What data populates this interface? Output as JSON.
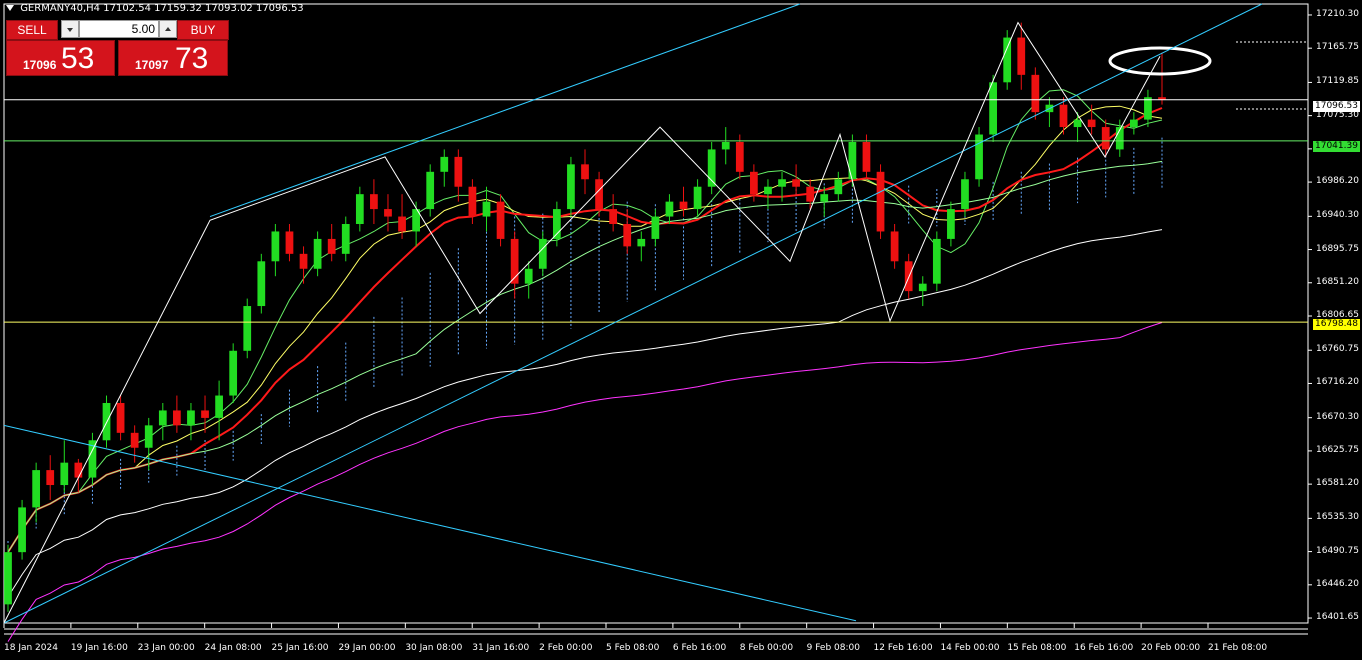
{
  "header": {
    "symbol": "GERMANY40,H4",
    "open": "17102.54",
    "high": "17159.32",
    "low": "17093.02",
    "close": "17096.53"
  },
  "trade_panel": {
    "sell_label": "SELL",
    "buy_label": "BUY",
    "volume": "5.00",
    "bid_small": "17096",
    "bid_big": "53",
    "ask_small": "17097",
    "ask_big": "73"
  },
  "price_labels": {
    "current": "17096.53",
    "green_level": "17041.39",
    "yellow_level": "16798.48",
    "current_bg": "#ffffff",
    "green_bg": "#33dd33",
    "yellow_bg": "#ffff00"
  },
  "colors": {
    "bull": "#22dd22",
    "bear": "#ee1111",
    "ma_red": "#ff1a1a",
    "ma_white": "#ffffff",
    "ma_magenta": "#ff33ff",
    "channel": "#33ccff",
    "cloud": "#66aaff",
    "level_green": "#66ee66",
    "level_yellow": "#ffff66"
  },
  "chart_data": {
    "type": "candlestick",
    "title": "GERMANY40,H4",
    "y_axis_ticks": [
      "17210.30",
      "17165.75",
      "17119.85",
      "17075.30",
      "17030.75",
      "16986.20",
      "16940.30",
      "16895.75",
      "16851.20",
      "16806.65",
      "16760.75",
      "16716.20",
      "16670.30",
      "16625.75",
      "16581.20",
      "16535.30",
      "16490.75",
      "16446.20",
      "16401.65"
    ],
    "ylim": [
      16395,
      17225
    ],
    "x_axis_ticks": [
      "18 Jan 2024",
      "19 Jan 16:00",
      "23 Jan 00:00",
      "24 Jan 08:00",
      "25 Jan 16:00",
      "29 Jan 00:00",
      "30 Jan 08:00",
      "31 Jan 16:00",
      "2 Feb 00:00",
      "5 Feb 08:00",
      "6 Feb 16:00",
      "8 Feb 00:00",
      "9 Feb 08:00",
      "12 Feb 16:00",
      "14 Feb 00:00",
      "15 Feb 08:00",
      "16 Feb 16:00",
      "20 Feb 00:00",
      "21 Feb 08:00"
    ],
    "horizontal_levels": [
      17096.53,
      17041.39,
      16798.48
    ],
    "candles_ohlc": [
      [
        16420,
        16500,
        16410,
        16490
      ],
      [
        16490,
        16560,
        16480,
        16550
      ],
      [
        16550,
        16610,
        16530,
        16600
      ],
      [
        16600,
        16620,
        16560,
        16580
      ],
      [
        16580,
        16640,
        16570,
        16610
      ],
      [
        16610,
        16615,
        16570,
        16590
      ],
      [
        16590,
        16650,
        16580,
        16640
      ],
      [
        16640,
        16700,
        16630,
        16690
      ],
      [
        16690,
        16700,
        16640,
        16650
      ],
      [
        16650,
        16660,
        16610,
        16630
      ],
      [
        16630,
        16670,
        16600,
        16660
      ],
      [
        16660,
        16690,
        16640,
        16680
      ],
      [
        16680,
        16700,
        16650,
        16660
      ],
      [
        16660,
        16690,
        16640,
        16680
      ],
      [
        16680,
        16700,
        16650,
        16670
      ],
      [
        16670,
        16720,
        16640,
        16700
      ],
      [
        16700,
        16770,
        16690,
        16760
      ],
      [
        16760,
        16830,
        16750,
        16820
      ],
      [
        16820,
        16890,
        16810,
        16880
      ],
      [
        16880,
        16930,
        16860,
        16920
      ],
      [
        16920,
        16930,
        16880,
        16890
      ],
      [
        16890,
        16900,
        16850,
        16870
      ],
      [
        16870,
        16920,
        16860,
        16910
      ],
      [
        16910,
        16930,
        16880,
        16890
      ],
      [
        16890,
        16940,
        16880,
        16930
      ],
      [
        16930,
        16980,
        16920,
        16970
      ],
      [
        16970,
        16990,
        16930,
        16950
      ],
      [
        16950,
        16970,
        16920,
        16940
      ],
      [
        16940,
        16970,
        16910,
        16920
      ],
      [
        16920,
        16960,
        16900,
        16950
      ],
      [
        16950,
        17010,
        16940,
        17000
      ],
      [
        17000,
        17030,
        16980,
        17020
      ],
      [
        17020,
        17030,
        16960,
        16980
      ],
      [
        16980,
        16990,
        16930,
        16940
      ],
      [
        16940,
        16980,
        16920,
        16960
      ],
      [
        16960,
        16970,
        16900,
        16910
      ],
      [
        16910,
        16920,
        16830,
        16850
      ],
      [
        16850,
        16880,
        16830,
        16870
      ],
      [
        16870,
        16920,
        16860,
        16910
      ],
      [
        16910,
        16960,
        16900,
        16950
      ],
      [
        16950,
        17020,
        16940,
        17010
      ],
      [
        17010,
        17030,
        16970,
        16990
      ],
      [
        16990,
        17000,
        16940,
        16950
      ],
      [
        16950,
        16970,
        16920,
        16930
      ],
      [
        16930,
        16950,
        16890,
        16900
      ],
      [
        16900,
        16920,
        16880,
        16910
      ],
      [
        16910,
        16950,
        16900,
        16940
      ],
      [
        16940,
        16970,
        16930,
        16960
      ],
      [
        16960,
        16980,
        16940,
        16950
      ],
      [
        16950,
        16990,
        16940,
        16980
      ],
      [
        16980,
        17040,
        16970,
        17030
      ],
      [
        17030,
        17060,
        17010,
        17040
      ],
      [
        17040,
        17050,
        16990,
        17000
      ],
      [
        17000,
        17010,
        16960,
        16970
      ],
      [
        16970,
        16990,
        16950,
        16980
      ],
      [
        16980,
        17000,
        16960,
        16990
      ],
      [
        16990,
        17010,
        16970,
        16980
      ],
      [
        16980,
        16990,
        16950,
        16960
      ],
      [
        16960,
        16980,
        16940,
        16970
      ],
      [
        16970,
        17000,
        16960,
        16990
      ],
      [
        16990,
        17050,
        16980,
        17040
      ],
      [
        17040,
        17050,
        16990,
        17000
      ],
      [
        17000,
        17010,
        16910,
        16920
      ],
      [
        16920,
        16930,
        16870,
        16880
      ],
      [
        16880,
        16890,
        16830,
        16840
      ],
      [
        16840,
        16860,
        16820,
        16850
      ],
      [
        16850,
        16920,
        16840,
        16910
      ],
      [
        16910,
        16960,
        16900,
        16950
      ],
      [
        16950,
        17000,
        16940,
        16990
      ],
      [
        16990,
        17060,
        16980,
        17050
      ],
      [
        17050,
        17130,
        17040,
        17120
      ],
      [
        17120,
        17190,
        17110,
        17180
      ],
      [
        17180,
        17200,
        17110,
        17130
      ],
      [
        17130,
        17140,
        17070,
        17080
      ],
      [
        17080,
        17100,
        17060,
        17090
      ],
      [
        17090,
        17100,
        17050,
        17060
      ],
      [
        17060,
        17080,
        17040,
        17070
      ],
      [
        17070,
        17090,
        17050,
        17060
      ],
      [
        17060,
        17070,
        17020,
        17030
      ],
      [
        17030,
        17070,
        17020,
        17060
      ],
      [
        17060,
        17080,
        17050,
        17070
      ],
      [
        17070,
        17110,
        17060,
        17100
      ],
      [
        17100,
        17160,
        17090,
        17097
      ]
    ]
  }
}
